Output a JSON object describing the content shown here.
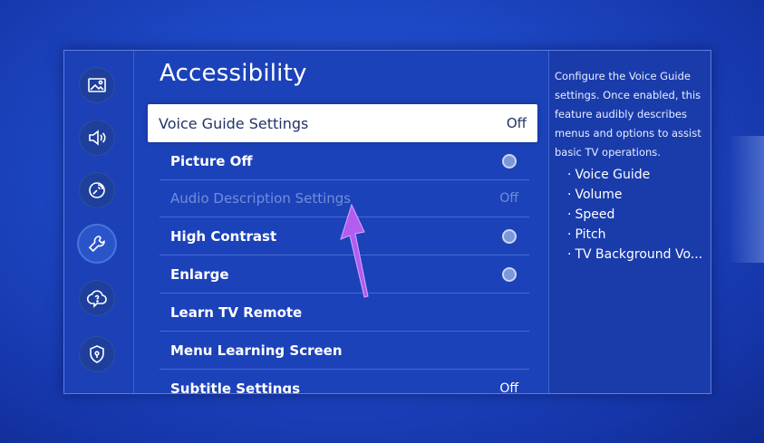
{
  "page_title": "Accessibility",
  "sidebar": {
    "items": [
      {
        "icon": "picture-icon",
        "active": false
      },
      {
        "icon": "sound-icon",
        "active": false
      },
      {
        "icon": "broadcasting-icon",
        "active": false
      },
      {
        "icon": "wrench-icon",
        "active": true
      },
      {
        "icon": "support-icon",
        "active": false
      },
      {
        "icon": "privacy-shield-icon",
        "active": false
      }
    ]
  },
  "menu": {
    "items": [
      {
        "label": "Voice Guide Settings",
        "value": "Off",
        "selected": true
      },
      {
        "label": "Picture Off",
        "toggle": true
      },
      {
        "label": "Audio Description Settings",
        "value": "Off",
        "disabled": true
      },
      {
        "label": "High Contrast",
        "toggle": true
      },
      {
        "label": "Enlarge",
        "toggle": true
      },
      {
        "label": "Learn TV Remote"
      },
      {
        "label": "Menu Learning Screen"
      },
      {
        "label": "Subtitle Settings",
        "value": "Off"
      }
    ]
  },
  "info": {
    "description": "Configure the Voice Guide settings. Once enabled, this feature audibly describes menus and options to assist basic TV operations.",
    "list": [
      "Voice Guide",
      "Volume",
      "Speed",
      "Pitch",
      "TV Background Vo..."
    ]
  },
  "colors": {
    "background": "#1d47c4",
    "menu_bg": "#1c42ba",
    "selected_bg": "#ffffff",
    "pointer": "#b35cf0"
  }
}
